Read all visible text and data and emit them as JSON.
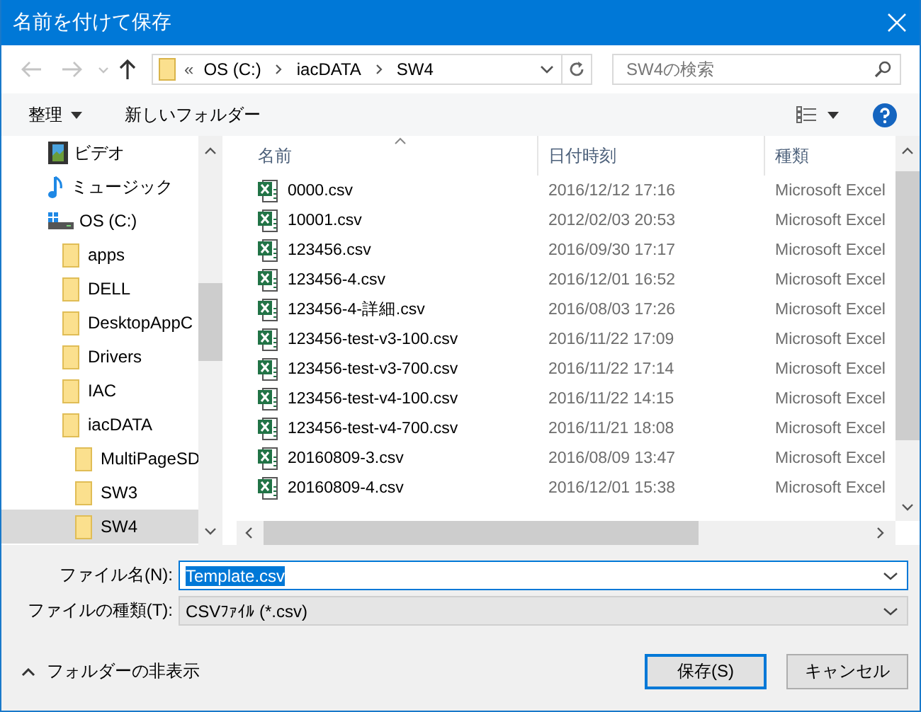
{
  "window": {
    "title": "名前を付けて保存"
  },
  "nav_buttons": [
    {
      "kind": "back",
      "disabled": true
    },
    {
      "kind": "forward",
      "disabled": true
    },
    {
      "kind": "recent",
      "disabled": true
    },
    {
      "kind": "up",
      "disabled": false
    }
  ],
  "address_bar": {
    "overflow": "«",
    "crumbs": [
      "OS (C:)",
      "iacDATA",
      "SW4"
    ]
  },
  "search": {
    "placeholder": "SW4の検索"
  },
  "toolbar": {
    "organize": "整理",
    "new_folder": "新しいフォルダー"
  },
  "sidebar": {
    "items": [
      {
        "kind": "video",
        "label": "ビデオ",
        "selected": false
      },
      {
        "kind": "music",
        "label": "ミュージック",
        "selected": false
      },
      {
        "kind": "drive",
        "label": "OS (C:)",
        "selected": false,
        "children": [
          {
            "kind": "folder",
            "label": "apps",
            "selected": false
          },
          {
            "kind": "folder",
            "label": "DELL",
            "selected": false
          },
          {
            "kind": "folder",
            "label": "DesktopAppC",
            "selected": false
          },
          {
            "kind": "folder",
            "label": "Drivers",
            "selected": false
          },
          {
            "kind": "folder",
            "label": "IAC",
            "selected": false
          },
          {
            "kind": "folder",
            "label": "iacDATA",
            "selected": false,
            "children": [
              {
                "kind": "folder",
                "label": "MultiPageSD",
                "selected": false
              },
              {
                "kind": "folder",
                "label": "SW3",
                "selected": false
              },
              {
                "kind": "folder",
                "label": "SW4",
                "selected": true
              }
            ]
          }
        ]
      }
    ]
  },
  "file_list": {
    "columns": [
      "名前",
      "日付時刻",
      "種類"
    ],
    "rows": [
      {
        "name": "0000.csv",
        "date": "2016/12/12 17:16",
        "type": "Microsoft Excel"
      },
      {
        "name": "10001.csv",
        "date": "2012/02/03 20:53",
        "type": "Microsoft Excel"
      },
      {
        "name": "123456.csv",
        "date": "2016/09/30 17:17",
        "type": "Microsoft Excel"
      },
      {
        "name": "123456-4.csv",
        "date": "2016/12/01 16:52",
        "type": "Microsoft Excel"
      },
      {
        "name": "123456-4-詳細.csv",
        "date": "2016/08/03 17:26",
        "type": "Microsoft Excel"
      },
      {
        "name": "123456-test-v3-100.csv",
        "date": "2016/11/22 17:09",
        "type": "Microsoft Excel"
      },
      {
        "name": "123456-test-v3-700.csv",
        "date": "2016/11/22 17:14",
        "type": "Microsoft Excel"
      },
      {
        "name": "123456-test-v4-100.csv",
        "date": "2016/11/22 14:15",
        "type": "Microsoft Excel"
      },
      {
        "name": "123456-test-v4-700.csv",
        "date": "2016/11/21 18:08",
        "type": "Microsoft Excel"
      },
      {
        "name": "20160809-3.csv",
        "date": "2016/08/09 13:47",
        "type": "Microsoft Excel"
      },
      {
        "name": "20160809-4.csv",
        "date": "2016/12/01 15:38",
        "type": "Microsoft Excel"
      }
    ]
  },
  "file_name": {
    "label": "ファイル名(N):",
    "value": "Template.csv",
    "value_selected": true
  },
  "file_type": {
    "label": "ファイルの種類(T):",
    "value": "CSVﾌｧｲﾙ (*.csv)"
  },
  "hide_folders": "フォルダーの非表示",
  "buttons": [
    {
      "label": "保存(S)",
      "default": true
    },
    {
      "label": "キャンセル",
      "default": false
    }
  ]
}
